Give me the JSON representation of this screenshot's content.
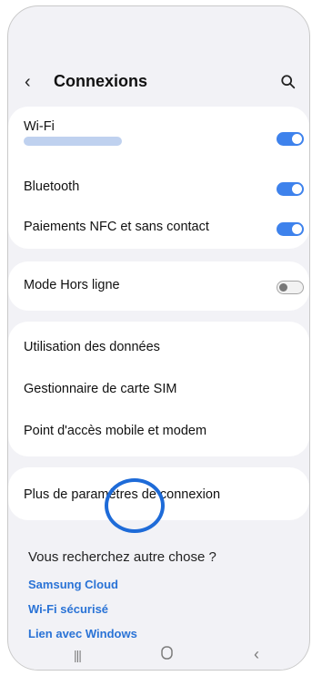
{
  "header": {
    "title": "Connexions"
  },
  "connections_group": [
    {
      "label": "Wi-Fi",
      "toggle": true
    },
    {
      "label": "Bluetooth",
      "toggle": true
    },
    {
      "label": "Paiements NFC et sans contact",
      "toggle": true
    }
  ],
  "offline_group": [
    {
      "label": "Mode Hors ligne",
      "toggle": false
    }
  ],
  "data_group": [
    {
      "label": "Utilisation des données"
    },
    {
      "label": "Gestionnaire de carte SIM"
    },
    {
      "label": "Point d'accès mobile et modem"
    }
  ],
  "more_group": [
    {
      "label": "Plus de paramètres de connexion"
    }
  ],
  "suggestions": {
    "title": "Vous recherchez autre chose ?",
    "links": [
      "Samsung Cloud",
      "Wi-Fi sécurisé",
      "Lien avec Windows"
    ]
  },
  "navigation": {
    "recent_icon": "recent-apps-icon",
    "home_icon": "home-icon",
    "back_icon": "back-icon"
  },
  "colors": {
    "accent": "#3e82ec",
    "highlight": "#1e6bd8",
    "link": "#2a73d6",
    "background": "#f2f2f6"
  }
}
